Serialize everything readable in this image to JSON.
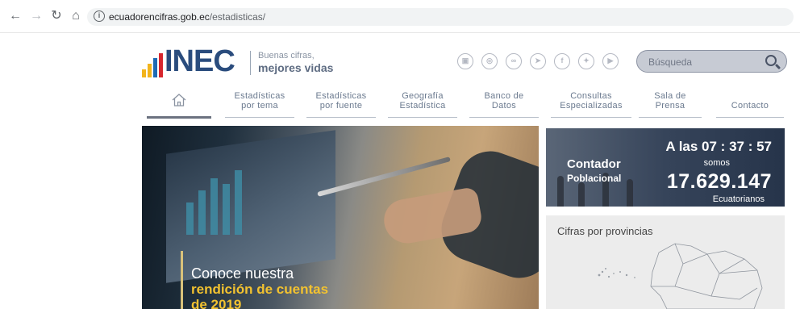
{
  "browser": {
    "url_host": "ecuadorencifras.gob.ec",
    "url_path": "/estadisticas/"
  },
  "header": {
    "logo_text": "INEC",
    "slogan_line1": "Buenas cifras,",
    "slogan_line2": "mejores vidas",
    "search_placeholder": "Búsqueda",
    "social_icons": [
      "blog-icon",
      "instagram-icon",
      "flickr-icon",
      "telegram-icon",
      "facebook-icon",
      "twitter-icon",
      "youtube-icon"
    ]
  },
  "nav": {
    "items": [
      {
        "line1": "",
        "line2": ""
      },
      {
        "line1": "Estadísticas",
        "line2": "por tema"
      },
      {
        "line1": "Estadísticas",
        "line2": "por fuente"
      },
      {
        "line1": "Geografía",
        "line2": "Estadística"
      },
      {
        "line1": "Banco de",
        "line2": "Datos"
      },
      {
        "line1": "Consultas",
        "line2": "Especializadas"
      },
      {
        "line1": "Sala de",
        "line2": "Prensa"
      },
      {
        "line1": "",
        "line2": "Contacto"
      }
    ]
  },
  "hero": {
    "line1": "Conoce nuestra",
    "line2": "rendición de cuentas",
    "line3": "de 2019"
  },
  "counter": {
    "label1": "Contador",
    "label2": "Poblacional",
    "time": "A las  07 : 37 : 57",
    "somos": "somos",
    "population": "17.629.147",
    "ecuatorianos": "Ecuatorianos"
  },
  "provinces": {
    "title": "Cifras por provincias"
  },
  "colors": {
    "logo_blue": "#2a4c7d",
    "logo_bar_yellow": "#f2b41c",
    "logo_bar_blue": "#1e6ab4",
    "logo_bar_red": "#d7262e",
    "accent_yellow": "#f2c230"
  }
}
